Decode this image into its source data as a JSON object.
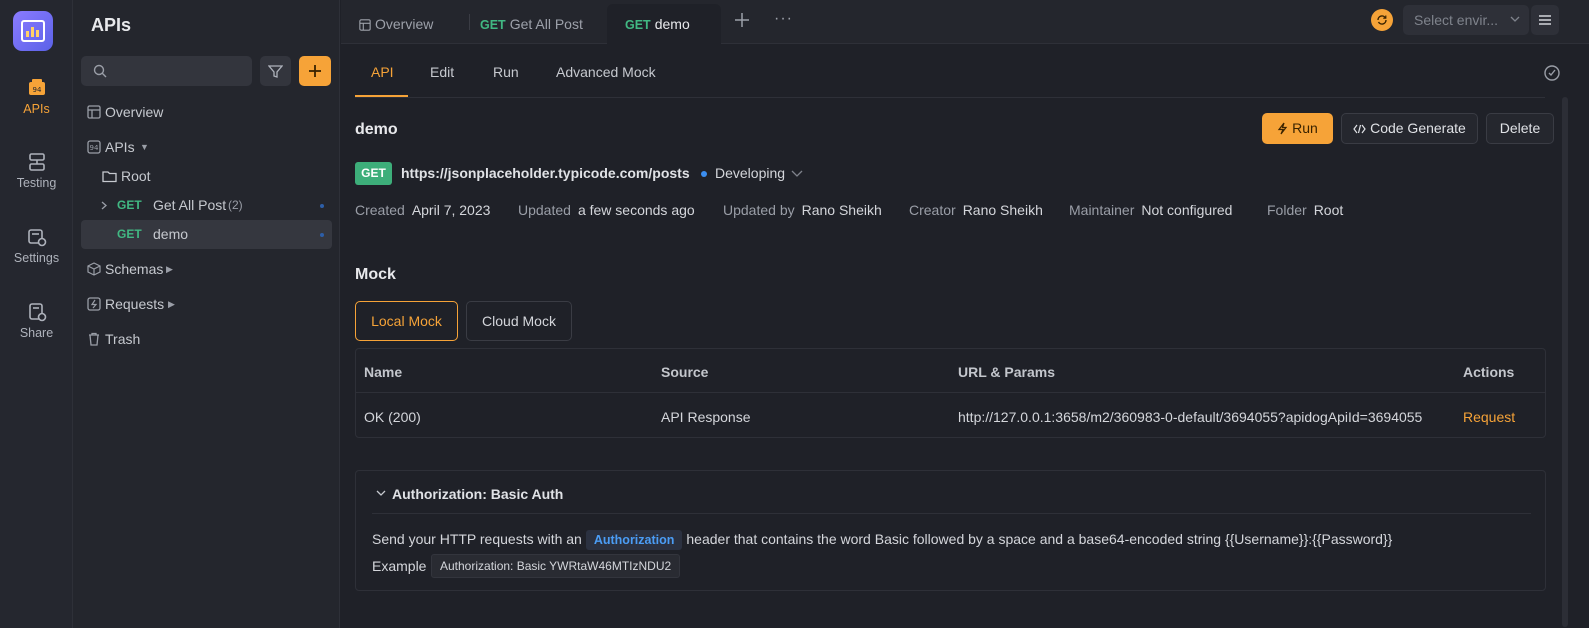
{
  "rail": {
    "items": [
      {
        "label": "APIs",
        "icon": "apis-icon"
      },
      {
        "label": "Testing",
        "icon": "testing-icon"
      },
      {
        "label": "Settings",
        "icon": "settings-icon"
      },
      {
        "label": "Share",
        "icon": "share-icon"
      }
    ]
  },
  "sidebar": {
    "title": "APIs",
    "search_placeholder": "",
    "tree": {
      "overview": "Overview",
      "apis": "APIs",
      "root": "Root",
      "get_all_post_method": "GET",
      "get_all_post": "Get All Post",
      "get_all_post_count": "(2)",
      "demo_method": "GET",
      "demo": "demo",
      "schemas": "Schemas",
      "requests": "Requests",
      "trash": "Trash"
    }
  },
  "tabs": {
    "overview": "Overview",
    "get_all_post_method": "GET",
    "get_all_post": "Get All Post",
    "demo_method": "GET",
    "demo": "demo",
    "more": "···"
  },
  "env": {
    "placeholder": "Select envir..."
  },
  "subtabs": [
    "API",
    "Edit",
    "Run",
    "Advanced Mock"
  ],
  "api": {
    "name": "demo",
    "method": "GET",
    "url": "https://jsonplaceholder.typicode.com/posts",
    "status": "Developing",
    "run_label": "Run",
    "code_label": "Code Generate",
    "delete_label": "Delete",
    "meta": [
      {
        "k": "Created",
        "v": "April 7, 2023"
      },
      {
        "k": "Updated",
        "v": "a few seconds ago"
      },
      {
        "k": "Updated by",
        "v": "Rano Sheikh"
      },
      {
        "k": "Creator",
        "v": "Rano Sheikh"
      },
      {
        "k": "Maintainer",
        "v": "Not configured"
      },
      {
        "k": "Folder",
        "v": "Root"
      }
    ]
  },
  "mock": {
    "title": "Mock",
    "local": "Local Mock",
    "cloud": "Cloud Mock",
    "columns": [
      "Name",
      "Source",
      "URL & Params",
      "Actions"
    ],
    "row": {
      "name": "OK (200)",
      "source": "API Response",
      "url": "http://127.0.0.1:3658/m2/360983-0-default/3694055?apidogApiId=3694055",
      "action": "Request"
    }
  },
  "auth": {
    "title": "Authorization: Basic Auth",
    "line_pre": "Send your HTTP requests with an",
    "code": "Authorization",
    "line_post": "header that contains the word Basic followed by a space and a base64-encoded string {{Username}}:{{Password}}",
    "example_label": "Example",
    "example_value": "Authorization: Basic YWRtaW46MTIzNDU2"
  },
  "colors": {
    "accent": "#f6a338",
    "get": "#41b883",
    "bg": "#1f2128"
  }
}
